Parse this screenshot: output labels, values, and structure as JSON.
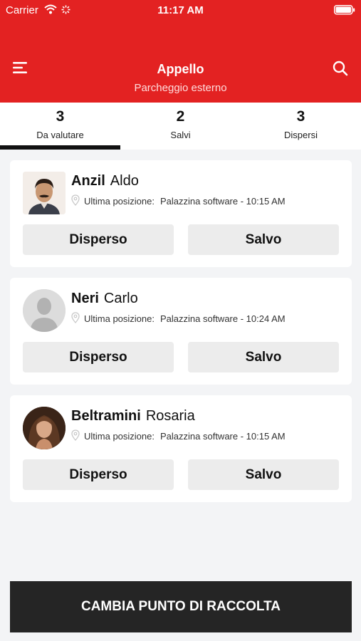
{
  "status_bar": {
    "carrier": "Carrier",
    "time": "11:17 AM"
  },
  "header": {
    "title": "Appello",
    "subtitle": "Parcheggio esterno"
  },
  "tabs": [
    {
      "count": "3",
      "label": "Da valutare",
      "active": true
    },
    {
      "count": "2",
      "label": "Salvi",
      "active": false
    },
    {
      "count": "3",
      "label": "Dispersi",
      "active": false
    }
  ],
  "people": [
    {
      "last_name": "Anzil",
      "first_name": "Aldo",
      "location_label": "Ultima posizione:",
      "location_value": "Palazzina software - 10:15 AM",
      "lost_label": "Disperso",
      "safe_label": "Salvo"
    },
    {
      "last_name": "Neri",
      "first_name": "Carlo",
      "location_label": "Ultima posizione:",
      "location_value": "Palazzina software - 10:24 AM",
      "lost_label": "Disperso",
      "safe_label": "Salvo"
    },
    {
      "last_name": "Beltramini",
      "first_name": "Rosaria",
      "location_label": "Ultima posizione:",
      "location_value": "Palazzina software - 10:15 AM",
      "lost_label": "Disperso",
      "safe_label": "Salvo"
    }
  ],
  "footer": {
    "button_label": "CAMBIA PUNTO DI RACCOLTA"
  },
  "colors": {
    "header": "#e32222",
    "footer_button": "#252525",
    "action_button": "#ececec"
  }
}
